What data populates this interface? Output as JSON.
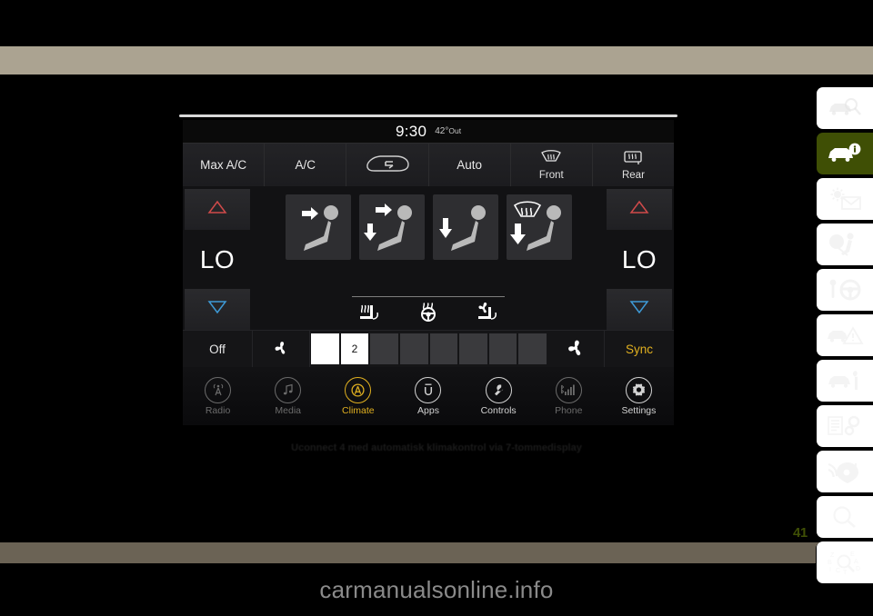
{
  "page": {
    "number": "41",
    "caption": "Uconnect 4 med automatisk klimakontrol via 7-tommedisplay",
    "watermark": "carmanualsonline.info",
    "band_top_color": "#aba391",
    "band_bottom_color": "#6b6355",
    "accent_green": "#3f4f05",
    "accent_amber": "#e0b020"
  },
  "rail": {
    "tabs": [
      {
        "name": "vehicle-overview-icon",
        "active": false
      },
      {
        "name": "getting-to-know-vehicle-icon",
        "active": true
      },
      {
        "name": "comfort-features-icon",
        "active": false
      },
      {
        "name": "safety-restraints-icon",
        "active": false
      },
      {
        "name": "starting-and-operating-icon",
        "active": false
      },
      {
        "name": "warning-lights-icon",
        "active": false
      },
      {
        "name": "servicing-maintenance-icon",
        "active": false
      },
      {
        "name": "specifications-icon",
        "active": false
      },
      {
        "name": "multimedia-icon",
        "active": false
      },
      {
        "name": "search-icon",
        "active": false
      },
      {
        "name": "index-icon",
        "active": false
      }
    ]
  },
  "head_unit": {
    "status": {
      "clock": "9:30",
      "outside_temp_value": "42°",
      "outside_temp_label": "Out"
    },
    "top_buttons": [
      {
        "name": "max-ac-button",
        "label": "Max A/C",
        "sub": ""
      },
      {
        "name": "ac-button",
        "label": "A/C",
        "sub": ""
      },
      {
        "name": "recirculation-button",
        "label": "",
        "sub": "",
        "icon": "recirculation-icon"
      },
      {
        "name": "auto-button",
        "label": "Auto",
        "sub": ""
      },
      {
        "name": "front-defrost-button",
        "label": "",
        "sub": "Front",
        "icon": "front-defrost-icon"
      },
      {
        "name": "rear-defrost-button",
        "label": "",
        "sub": "Rear",
        "icon": "rear-defrost-icon"
      }
    ],
    "left_zone": {
      "name": "driver-temperature-zone",
      "up_label": "temp-up-arrow",
      "value": "LO",
      "down_label": "temp-down-arrow",
      "up_color": "#d04a4a",
      "down_color": "#3e9ad6"
    },
    "right_zone": {
      "name": "passenger-temperature-zone",
      "up_label": "temp-up-arrow",
      "value": "LO",
      "down_label": "temp-down-arrow",
      "up_color": "#d04a4a",
      "down_color": "#3e9ad6"
    },
    "airflow_modes": [
      {
        "name": "airflow-face-button",
        "icon": "seat-face-icon"
      },
      {
        "name": "airflow-face-and-feet-button",
        "icon": "seat-face-feet-icon"
      },
      {
        "name": "airflow-feet-button",
        "icon": "seat-feet-icon"
      },
      {
        "name": "airflow-feet-and-defrost-button",
        "icon": "seat-feet-defrost-icon"
      }
    ],
    "comfort_icons": [
      {
        "name": "heated-seat-icon"
      },
      {
        "name": "heated-steering-wheel-icon"
      },
      {
        "name": "ventilated-seat-icon"
      }
    ],
    "fan_row": {
      "off_label": "Off",
      "fan_low_icon": "fan-low-icon",
      "fan_high_icon": "fan-high-icon",
      "sync_label": "Sync",
      "segments": 8,
      "active_segments": 2,
      "level_label": "2"
    },
    "nav": [
      {
        "name": "nav-radio",
        "label": "Radio",
        "state": "dim",
        "icon": "radio-antenna-icon"
      },
      {
        "name": "nav-media",
        "label": "Media",
        "state": "dim",
        "icon": "music-note-icon"
      },
      {
        "name": "nav-climate",
        "label": "Climate",
        "state": "active",
        "icon": "climate-auto-icon"
      },
      {
        "name": "nav-apps",
        "label": "Apps",
        "state": "normal",
        "icon": "uconnect-u-icon"
      },
      {
        "name": "nav-controls",
        "label": "Controls",
        "state": "normal",
        "icon": "wrench-icon"
      },
      {
        "name": "nav-phone",
        "label": "Phone",
        "state": "dim",
        "icon": "phone-signal-icon"
      },
      {
        "name": "nav-settings",
        "label": "Settings",
        "state": "normal",
        "icon": "gear-icon"
      }
    ]
  }
}
